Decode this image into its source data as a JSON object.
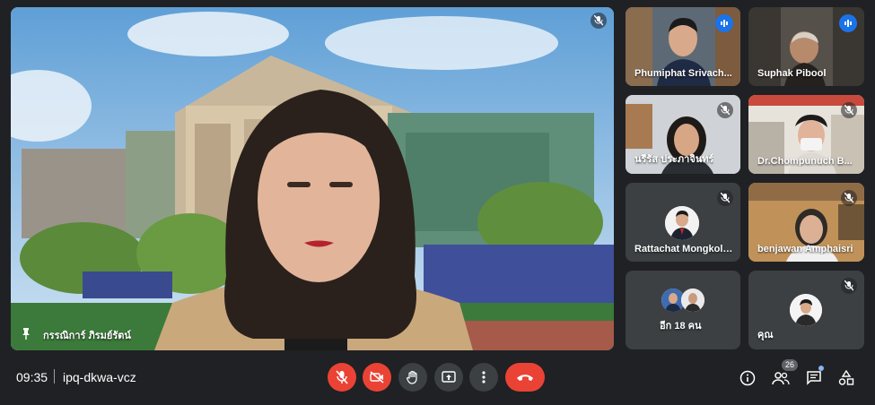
{
  "main_speaker": {
    "name": "กรรณิการ์ ภิรมย์รัตน์"
  },
  "participants": [
    {
      "name": "Phumiphat Srivach...",
      "state": "speaking"
    },
    {
      "name": "Suphak Pibool",
      "state": "speaking"
    },
    {
      "name": "นรีรัส ประภาจินทร์",
      "state": "muted"
    },
    {
      "name": "Dr.Chompunuch B...",
      "state": "muted"
    },
    {
      "name": "Rattachat Mongkoln...",
      "state": "muted"
    },
    {
      "name": "benjawan Amphaisri",
      "state": "muted"
    },
    {
      "name": "อีก 18 คน",
      "state": "group"
    },
    {
      "name": "คุณ",
      "state": "muted"
    }
  ],
  "bottom_bar": {
    "time": "09:35",
    "meeting_code": "ipq-dkwa-vcz",
    "people_count": "26"
  },
  "colors": {
    "background": "#202124",
    "danger": "#ea4335",
    "tile": "#3c4043",
    "speaking": "#1a73e8",
    "highlight": "#8ab4f8"
  }
}
